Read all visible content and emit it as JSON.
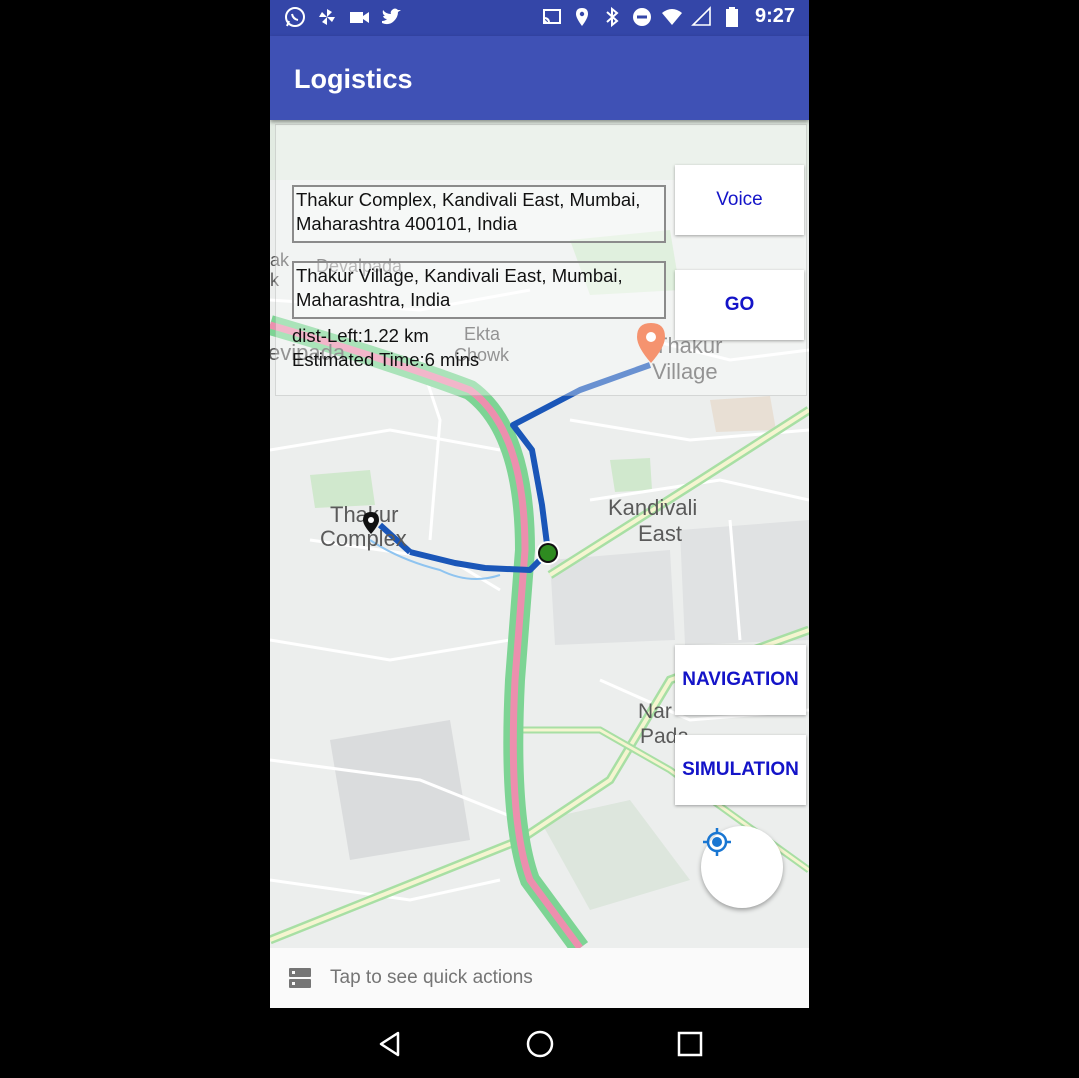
{
  "status_bar": {
    "time": "9:27",
    "left_icons": [
      "whatsapp-icon",
      "pinwheel-icon",
      "video-icon",
      "twitter-icon"
    ],
    "right_icons": [
      "cast-icon",
      "location-icon",
      "bluetooth-icon",
      "do-not-disturb-icon",
      "wifi-icon",
      "signal-icon",
      "battery-icon"
    ]
  },
  "app_bar": {
    "title": "Logistics"
  },
  "route_panel": {
    "source_address": "Thakur Complex, Kandivali East, Mumbai, Maharashtra 400101, India",
    "destination_address": "Thakur Village, Kandivali East, Mumbai, Maharashtra, India",
    "distance_left": "dist-Left:1.22 km",
    "estimated_time": "Estimated Time:6 mins"
  },
  "buttons": {
    "voice": "Voice",
    "go": "GO",
    "navigation": "NAVIGATION",
    "simulation": "SIMULATION"
  },
  "map_labels": {
    "thakur_complex_1": "Thakur",
    "thakur_complex_2": "Complex",
    "thakur_village_1": "Thakur",
    "thakur_village_2": "Village",
    "kandivali_east_1": "Kandivali",
    "kandivali_east_2": "East",
    "ekta_chowk_1": "Ekta",
    "ekta_chowk_2": "Chowk",
    "narsi_pada_1": "Nar",
    "narsi_pada_2": "Pada",
    "devipada": "evipada",
    "devalpada": "Devalpada",
    "edge_fragment_1": "ak",
    "edge_fragment_2": "k"
  },
  "colors": {
    "app_bar": "#3f51b5",
    "status_bar": "#3446a8",
    "button_text": "#1414c8",
    "route_line": "#1a56b8",
    "highway_green": "#6fcf8a",
    "highway_pink": "#e98aa8",
    "destination_pin": "#f05a22",
    "current_position": "#2e8b20"
  },
  "quick_actions": {
    "label": "Tap to see quick actions",
    "icon": "storage-icon"
  },
  "nav_bar": {
    "icons": [
      "back-icon",
      "home-icon",
      "recents-icon"
    ]
  }
}
